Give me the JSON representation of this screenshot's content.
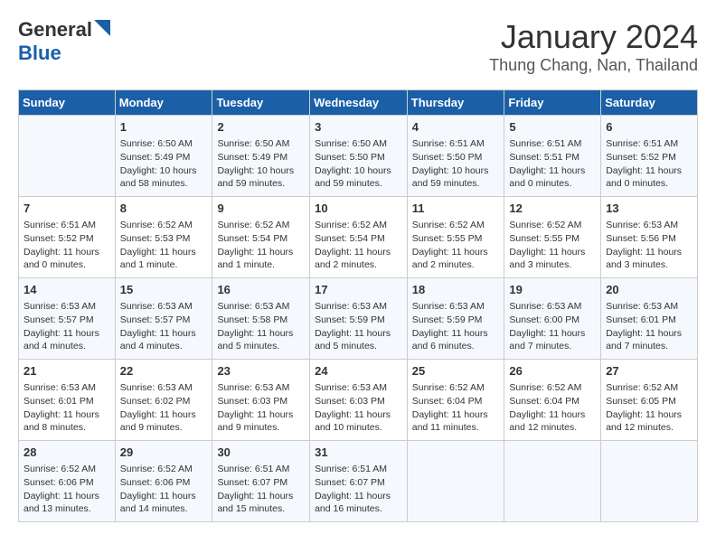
{
  "logo": {
    "line1": "General",
    "line2": "Blue"
  },
  "title": "January 2024",
  "subtitle": "Thung Chang, Nan, Thailand",
  "days_of_week": [
    "Sunday",
    "Monday",
    "Tuesday",
    "Wednesday",
    "Thursday",
    "Friday",
    "Saturday"
  ],
  "weeks": [
    [
      {
        "day": "",
        "info": ""
      },
      {
        "day": "1",
        "info": "Sunrise: 6:50 AM\nSunset: 5:49 PM\nDaylight: 10 hours\nand 58 minutes."
      },
      {
        "day": "2",
        "info": "Sunrise: 6:50 AM\nSunset: 5:49 PM\nDaylight: 10 hours\nand 59 minutes."
      },
      {
        "day": "3",
        "info": "Sunrise: 6:50 AM\nSunset: 5:50 PM\nDaylight: 10 hours\nand 59 minutes."
      },
      {
        "day": "4",
        "info": "Sunrise: 6:51 AM\nSunset: 5:50 PM\nDaylight: 10 hours\nand 59 minutes."
      },
      {
        "day": "5",
        "info": "Sunrise: 6:51 AM\nSunset: 5:51 PM\nDaylight: 11 hours\nand 0 minutes."
      },
      {
        "day": "6",
        "info": "Sunrise: 6:51 AM\nSunset: 5:52 PM\nDaylight: 11 hours\nand 0 minutes."
      }
    ],
    [
      {
        "day": "7",
        "info": "Sunrise: 6:51 AM\nSunset: 5:52 PM\nDaylight: 11 hours\nand 0 minutes."
      },
      {
        "day": "8",
        "info": "Sunrise: 6:52 AM\nSunset: 5:53 PM\nDaylight: 11 hours\nand 1 minute."
      },
      {
        "day": "9",
        "info": "Sunrise: 6:52 AM\nSunset: 5:54 PM\nDaylight: 11 hours\nand 1 minute."
      },
      {
        "day": "10",
        "info": "Sunrise: 6:52 AM\nSunset: 5:54 PM\nDaylight: 11 hours\nand 2 minutes."
      },
      {
        "day": "11",
        "info": "Sunrise: 6:52 AM\nSunset: 5:55 PM\nDaylight: 11 hours\nand 2 minutes."
      },
      {
        "day": "12",
        "info": "Sunrise: 6:52 AM\nSunset: 5:55 PM\nDaylight: 11 hours\nand 3 minutes."
      },
      {
        "day": "13",
        "info": "Sunrise: 6:53 AM\nSunset: 5:56 PM\nDaylight: 11 hours\nand 3 minutes."
      }
    ],
    [
      {
        "day": "14",
        "info": "Sunrise: 6:53 AM\nSunset: 5:57 PM\nDaylight: 11 hours\nand 4 minutes."
      },
      {
        "day": "15",
        "info": "Sunrise: 6:53 AM\nSunset: 5:57 PM\nDaylight: 11 hours\nand 4 minutes."
      },
      {
        "day": "16",
        "info": "Sunrise: 6:53 AM\nSunset: 5:58 PM\nDaylight: 11 hours\nand 5 minutes."
      },
      {
        "day": "17",
        "info": "Sunrise: 6:53 AM\nSunset: 5:59 PM\nDaylight: 11 hours\nand 5 minutes."
      },
      {
        "day": "18",
        "info": "Sunrise: 6:53 AM\nSunset: 5:59 PM\nDaylight: 11 hours\nand 6 minutes."
      },
      {
        "day": "19",
        "info": "Sunrise: 6:53 AM\nSunset: 6:00 PM\nDaylight: 11 hours\nand 7 minutes."
      },
      {
        "day": "20",
        "info": "Sunrise: 6:53 AM\nSunset: 6:01 PM\nDaylight: 11 hours\nand 7 minutes."
      }
    ],
    [
      {
        "day": "21",
        "info": "Sunrise: 6:53 AM\nSunset: 6:01 PM\nDaylight: 11 hours\nand 8 minutes."
      },
      {
        "day": "22",
        "info": "Sunrise: 6:53 AM\nSunset: 6:02 PM\nDaylight: 11 hours\nand 9 minutes."
      },
      {
        "day": "23",
        "info": "Sunrise: 6:53 AM\nSunset: 6:03 PM\nDaylight: 11 hours\nand 9 minutes."
      },
      {
        "day": "24",
        "info": "Sunrise: 6:53 AM\nSunset: 6:03 PM\nDaylight: 11 hours\nand 10 minutes."
      },
      {
        "day": "25",
        "info": "Sunrise: 6:52 AM\nSunset: 6:04 PM\nDaylight: 11 hours\nand 11 minutes."
      },
      {
        "day": "26",
        "info": "Sunrise: 6:52 AM\nSunset: 6:04 PM\nDaylight: 11 hours\nand 12 minutes."
      },
      {
        "day": "27",
        "info": "Sunrise: 6:52 AM\nSunset: 6:05 PM\nDaylight: 11 hours\nand 12 minutes."
      }
    ],
    [
      {
        "day": "28",
        "info": "Sunrise: 6:52 AM\nSunset: 6:06 PM\nDaylight: 11 hours\nand 13 minutes."
      },
      {
        "day": "29",
        "info": "Sunrise: 6:52 AM\nSunset: 6:06 PM\nDaylight: 11 hours\nand 14 minutes."
      },
      {
        "day": "30",
        "info": "Sunrise: 6:51 AM\nSunset: 6:07 PM\nDaylight: 11 hours\nand 15 minutes."
      },
      {
        "day": "31",
        "info": "Sunrise: 6:51 AM\nSunset: 6:07 PM\nDaylight: 11 hours\nand 16 minutes."
      },
      {
        "day": "",
        "info": ""
      },
      {
        "day": "",
        "info": ""
      },
      {
        "day": "",
        "info": ""
      }
    ]
  ]
}
